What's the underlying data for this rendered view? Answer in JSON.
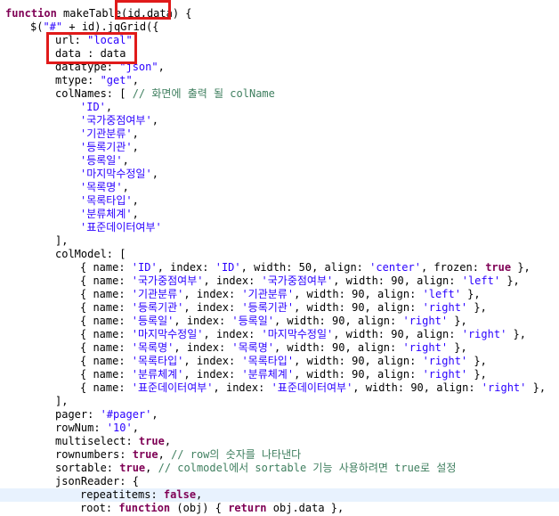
{
  "code_lines": [
    {
      "indent": 0,
      "segments": [
        {
          "t": "function",
          "c": "kw"
        },
        {
          "t": " makeTable"
        },
        {
          "t": "(id,data)"
        },
        {
          "t": " {"
        }
      ]
    },
    {
      "indent": 1,
      "segments": [
        {
          "t": "$("
        },
        {
          "t": "\"#\"",
          "c": "str"
        },
        {
          "t": " + id).jqGrid({"
        }
      ]
    },
    {
      "indent": 2,
      "segments": [
        {
          "t": "url: "
        },
        {
          "t": "\"local\"",
          "c": "str"
        },
        {
          "t": ","
        }
      ]
    },
    {
      "indent": 2,
      "segments": [
        {
          "t": "data : data ,"
        }
      ]
    },
    {
      "indent": 2,
      "segments": [
        {
          "t": "datatype: "
        },
        {
          "t": "\"json\"",
          "c": "str"
        },
        {
          "t": ","
        }
      ]
    },
    {
      "indent": 2,
      "segments": [
        {
          "t": "mtype: "
        },
        {
          "t": "\"get\"",
          "c": "str"
        },
        {
          "t": ","
        }
      ]
    },
    {
      "indent": 2,
      "segments": [
        {
          "t": "colNames: [ "
        },
        {
          "t": "// 화면에 출력 될 colName",
          "c": "cmt"
        }
      ]
    },
    {
      "indent": 3,
      "segments": [
        {
          "t": "'ID'",
          "c": "str"
        },
        {
          "t": ","
        }
      ]
    },
    {
      "indent": 3,
      "segments": [
        {
          "t": "'국가중점여부'",
          "c": "str"
        },
        {
          "t": ","
        }
      ]
    },
    {
      "indent": 3,
      "segments": [
        {
          "t": "'기관분류'",
          "c": "str"
        },
        {
          "t": ","
        }
      ]
    },
    {
      "indent": 3,
      "segments": [
        {
          "t": "'등록기관'",
          "c": "str"
        },
        {
          "t": ","
        }
      ]
    },
    {
      "indent": 3,
      "segments": [
        {
          "t": "'등록일'",
          "c": "str"
        },
        {
          "t": ","
        }
      ]
    },
    {
      "indent": 3,
      "segments": [
        {
          "t": "'마지막수정일'",
          "c": "str"
        },
        {
          "t": ","
        }
      ]
    },
    {
      "indent": 3,
      "segments": [
        {
          "t": "'목록명'",
          "c": "str"
        },
        {
          "t": ","
        }
      ]
    },
    {
      "indent": 3,
      "segments": [
        {
          "t": "'목록타입'",
          "c": "str"
        },
        {
          "t": ","
        }
      ]
    },
    {
      "indent": 3,
      "segments": [
        {
          "t": "'분류체계'",
          "c": "str"
        },
        {
          "t": ","
        }
      ]
    },
    {
      "indent": 3,
      "segments": [
        {
          "t": "'표준데이터여부'",
          "c": "str"
        }
      ]
    },
    {
      "indent": 2,
      "segments": [
        {
          "t": "],"
        }
      ]
    },
    {
      "indent": 2,
      "segments": [
        {
          "t": "colModel: ["
        }
      ]
    },
    {
      "indent": 3,
      "segments": [
        {
          "t": "{ name: "
        },
        {
          "t": "'ID'",
          "c": "str"
        },
        {
          "t": ", index: "
        },
        {
          "t": "'ID'",
          "c": "str"
        },
        {
          "t": ", width: 50, align: "
        },
        {
          "t": "'center'",
          "c": "str"
        },
        {
          "t": ", frozen: "
        },
        {
          "t": "true",
          "c": "kw"
        },
        {
          "t": " },"
        }
      ]
    },
    {
      "indent": 3,
      "segments": [
        {
          "t": "{ name: "
        },
        {
          "t": "'국가중점여부'",
          "c": "str"
        },
        {
          "t": ", index: "
        },
        {
          "t": "'국가중점여부'",
          "c": "str"
        },
        {
          "t": ", width: 90, align: "
        },
        {
          "t": "'left'",
          "c": "str"
        },
        {
          "t": " },"
        }
      ]
    },
    {
      "indent": 3,
      "segments": [
        {
          "t": "{ name: "
        },
        {
          "t": "'기관분류'",
          "c": "str"
        },
        {
          "t": ", index: "
        },
        {
          "t": "'기관분류'",
          "c": "str"
        },
        {
          "t": ", width: 90, align: "
        },
        {
          "t": "'left'",
          "c": "str"
        },
        {
          "t": " },"
        }
      ]
    },
    {
      "indent": 3,
      "segments": [
        {
          "t": "{ name: "
        },
        {
          "t": "'등록기관'",
          "c": "str"
        },
        {
          "t": ", index: "
        },
        {
          "t": "'등록기관'",
          "c": "str"
        },
        {
          "t": ", width: 90, align: "
        },
        {
          "t": "'right'",
          "c": "str"
        },
        {
          "t": " },"
        }
      ]
    },
    {
      "indent": 3,
      "segments": [
        {
          "t": "{ name: "
        },
        {
          "t": "'등록일'",
          "c": "str"
        },
        {
          "t": ", index: "
        },
        {
          "t": "'등록일'",
          "c": "str"
        },
        {
          "t": ", width: 90, align: "
        },
        {
          "t": "'right'",
          "c": "str"
        },
        {
          "t": " },"
        }
      ]
    },
    {
      "indent": 3,
      "segments": [
        {
          "t": "{ name: "
        },
        {
          "t": "'마지막수정일'",
          "c": "str"
        },
        {
          "t": ", index: "
        },
        {
          "t": "'마지막수정일'",
          "c": "str"
        },
        {
          "t": ", width: 90, align: "
        },
        {
          "t": "'right'",
          "c": "str"
        },
        {
          "t": " },"
        }
      ]
    },
    {
      "indent": 3,
      "segments": [
        {
          "t": "{ name: "
        },
        {
          "t": "'목록명'",
          "c": "str"
        },
        {
          "t": ", index: "
        },
        {
          "t": "'목록명'",
          "c": "str"
        },
        {
          "t": ", width: 90, align: "
        },
        {
          "t": "'right'",
          "c": "str"
        },
        {
          "t": " },"
        }
      ]
    },
    {
      "indent": 3,
      "segments": [
        {
          "t": "{ name: "
        },
        {
          "t": "'목록타입'",
          "c": "str"
        },
        {
          "t": ", index: "
        },
        {
          "t": "'목록타입'",
          "c": "str"
        },
        {
          "t": ", width: 90, align: "
        },
        {
          "t": "'right'",
          "c": "str"
        },
        {
          "t": " },"
        }
      ]
    },
    {
      "indent": 3,
      "segments": [
        {
          "t": "{ name: "
        },
        {
          "t": "'분류체계'",
          "c": "str"
        },
        {
          "t": ", index: "
        },
        {
          "t": "'분류체계'",
          "c": "str"
        },
        {
          "t": ", width: 90, align: "
        },
        {
          "t": "'right'",
          "c": "str"
        },
        {
          "t": " },"
        }
      ]
    },
    {
      "indent": 3,
      "segments": [
        {
          "t": "{ name: "
        },
        {
          "t": "'표준데이터여부'",
          "c": "str"
        },
        {
          "t": ", index: "
        },
        {
          "t": "'표준데이터여부'",
          "c": "str"
        },
        {
          "t": ", width: 90, align: "
        },
        {
          "t": "'right'",
          "c": "str"
        },
        {
          "t": " },"
        }
      ]
    },
    {
      "indent": 2,
      "segments": [
        {
          "t": "],"
        }
      ]
    },
    {
      "indent": 2,
      "segments": [
        {
          "t": "pager: "
        },
        {
          "t": "'#pager'",
          "c": "str"
        },
        {
          "t": ","
        }
      ]
    },
    {
      "indent": 2,
      "segments": [
        {
          "t": "rowNum: "
        },
        {
          "t": "'10'",
          "c": "str"
        },
        {
          "t": ","
        }
      ]
    },
    {
      "indent": 2,
      "segments": [
        {
          "t": "multiselect: "
        },
        {
          "t": "true",
          "c": "kw"
        },
        {
          "t": ","
        }
      ]
    },
    {
      "indent": 2,
      "segments": [
        {
          "t": "rownumbers: "
        },
        {
          "t": "true",
          "c": "kw"
        },
        {
          "t": ", "
        },
        {
          "t": "// row의 숫자를 나타낸다",
          "c": "cmt"
        }
      ]
    },
    {
      "indent": 2,
      "segments": [
        {
          "t": "sortable: "
        },
        {
          "t": "true",
          "c": "kw"
        },
        {
          "t": ", "
        },
        {
          "t": "// colmodel에서 sortable 기능 사용하려면 true로 설정",
          "c": "cmt"
        }
      ]
    },
    {
      "indent": 2,
      "segments": [
        {
          "t": "jsonReader: {"
        }
      ]
    },
    {
      "indent": 3,
      "current": true,
      "segments": [
        {
          "t": "repeatitems: "
        },
        {
          "t": "false",
          "c": "kw"
        },
        {
          "t": ","
        }
      ]
    },
    {
      "indent": 3,
      "segments": [
        {
          "t": "root: "
        },
        {
          "t": "function",
          "c": "kw"
        },
        {
          "t": " (obj) { "
        },
        {
          "t": "return",
          "c": "kw"
        },
        {
          "t": " obj.data },"
        }
      ]
    }
  ]
}
